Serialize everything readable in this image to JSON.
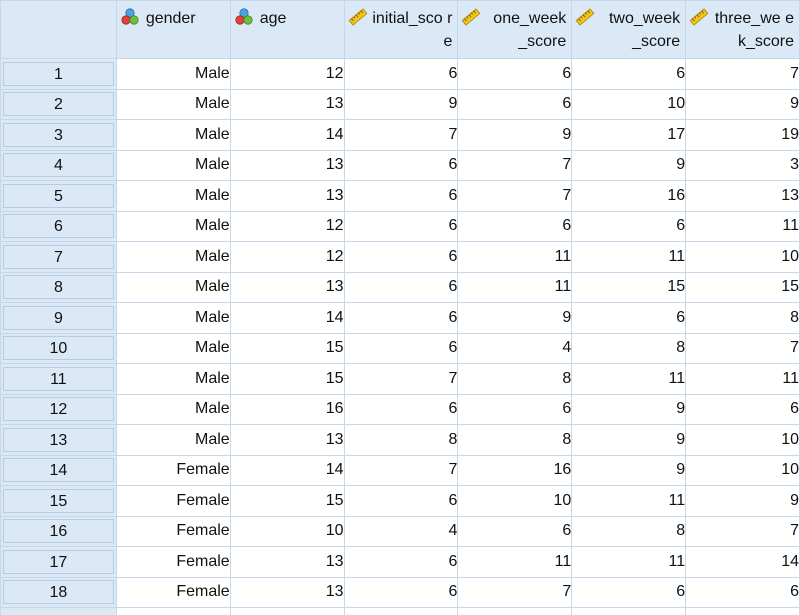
{
  "columns": [
    {
      "label": "gender",
      "type": "nominal",
      "icon": "nominal-measure-icon"
    },
    {
      "label": "age",
      "type": "nominal",
      "icon": "nominal-measure-icon"
    },
    {
      "label": "initial_sco re",
      "type": "scale",
      "icon": "scale-measure-icon"
    },
    {
      "label": "one_week _score",
      "type": "scale",
      "icon": "scale-measure-icon"
    },
    {
      "label": "two_week _score",
      "type": "scale",
      "icon": "scale-measure-icon"
    },
    {
      "label": "three_we ek_score",
      "type": "scale",
      "icon": "scale-measure-icon"
    }
  ],
  "rows": [
    {
      "n": "1",
      "cells": [
        "Male",
        "12",
        "6",
        "6",
        "6",
        "7"
      ]
    },
    {
      "n": "2",
      "cells": [
        "Male",
        "13",
        "9",
        "6",
        "10",
        "9"
      ]
    },
    {
      "n": "3",
      "cells": [
        "Male",
        "14",
        "7",
        "9",
        "17",
        "19"
      ]
    },
    {
      "n": "4",
      "cells": [
        "Male",
        "13",
        "6",
        "7",
        "9",
        "3"
      ]
    },
    {
      "n": "5",
      "cells": [
        "Male",
        "13",
        "6",
        "7",
        "16",
        "13"
      ]
    },
    {
      "n": "6",
      "cells": [
        "Male",
        "12",
        "6",
        "6",
        "6",
        "11"
      ]
    },
    {
      "n": "7",
      "cells": [
        "Male",
        "12",
        "6",
        "11",
        "11",
        "10"
      ]
    },
    {
      "n": "8",
      "cells": [
        "Male",
        "13",
        "6",
        "11",
        "15",
        "15"
      ]
    },
    {
      "n": "9",
      "cells": [
        "Male",
        "14",
        "6",
        "9",
        "6",
        "8"
      ]
    },
    {
      "n": "10",
      "cells": [
        "Male",
        "15",
        "6",
        "4",
        "8",
        "7"
      ]
    },
    {
      "n": "11",
      "cells": [
        "Male",
        "15",
        "7",
        "8",
        "11",
        "11"
      ]
    },
    {
      "n": "12",
      "cells": [
        "Male",
        "16",
        "6",
        "6",
        "9",
        "6"
      ]
    },
    {
      "n": "13",
      "cells": [
        "Male",
        "13",
        "8",
        "8",
        "9",
        "10"
      ]
    },
    {
      "n": "14",
      "cells": [
        "Female",
        "14",
        "7",
        "16",
        "9",
        "10"
      ]
    },
    {
      "n": "15",
      "cells": [
        "Female",
        "15",
        "6",
        "10",
        "11",
        "9"
      ]
    },
    {
      "n": "16",
      "cells": [
        "Female",
        "10",
        "4",
        "6",
        "8",
        "7"
      ]
    },
    {
      "n": "17",
      "cells": [
        "Female",
        "13",
        "6",
        "11",
        "11",
        "14"
      ]
    },
    {
      "n": "18",
      "cells": [
        "Female",
        "13",
        "6",
        "7",
        "6",
        "6"
      ]
    }
  ],
  "colors": {
    "header_bg": "#dbe8f6",
    "grid_line": "#c7d6e8",
    "cell_bg": "#ffffff"
  }
}
